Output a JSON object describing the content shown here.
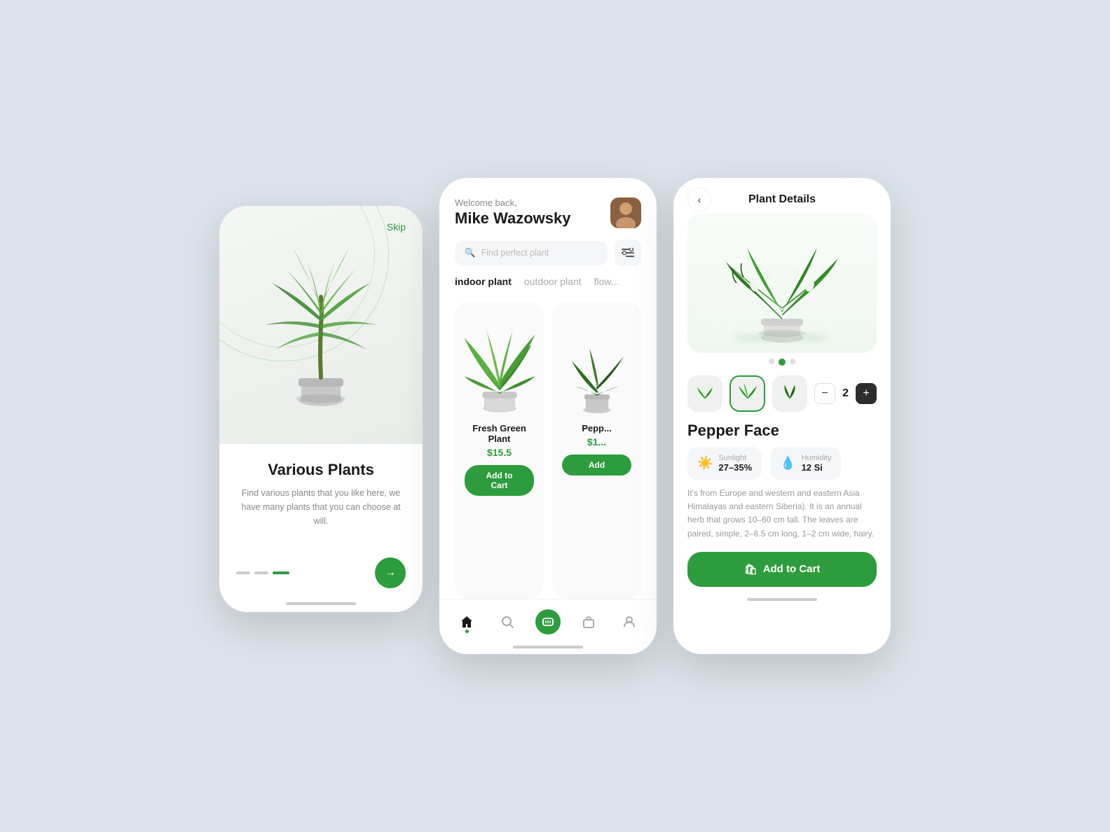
{
  "screen1": {
    "skip_label": "Skip",
    "title": "Various Plants",
    "description": "Find various plants that you like here, we have many plants that you can choose at will.",
    "next_arrow": "→",
    "dots": [
      "inactive",
      "inactive",
      "active"
    ]
  },
  "screen2": {
    "welcome": "Welcome back,",
    "user_name": "Mike Wazowsky",
    "search_placeholder": "Find perfect plant",
    "filter_icon": "⠿",
    "tabs": [
      {
        "label": "indoor plant",
        "active": true
      },
      {
        "label": "outdoor plant",
        "active": false
      },
      {
        "label": "flow...",
        "active": false
      }
    ],
    "plants": [
      {
        "name": "Fresh Green Plant",
        "price": "$15.5",
        "add_label": "Add to Cart"
      },
      {
        "name": "Pepp...",
        "price": "$1...",
        "add_label": "Add"
      }
    ],
    "nav_items": [
      "home",
      "search",
      "scan",
      "bag",
      "person"
    ]
  },
  "screen3": {
    "back_label": "‹",
    "title": "Plant Details",
    "plant_name": "Pepper Face",
    "quantity": "2",
    "stats": [
      {
        "icon": "☀",
        "label": "Sunlight",
        "value": "27–35%"
      },
      {
        "icon": "💧",
        "label": "Humidity",
        "value": "12 Si"
      }
    ],
    "description": "It's from Europe and western and eastern Asia Himalayas and eastern Siberia). It is an annual herb that grows 10–60 cm tall. The leaves are paired, simple, 2–6.5 cm long, 1–2 cm wide, hairy.",
    "add_cart_label": "Add to Cart",
    "cart_icon": "🛍"
  },
  "colors": {
    "primary_green": "#2d9c3c",
    "light_bg": "#f5f6f8",
    "text_dark": "#1a1a1a",
    "text_muted": "#888888"
  }
}
